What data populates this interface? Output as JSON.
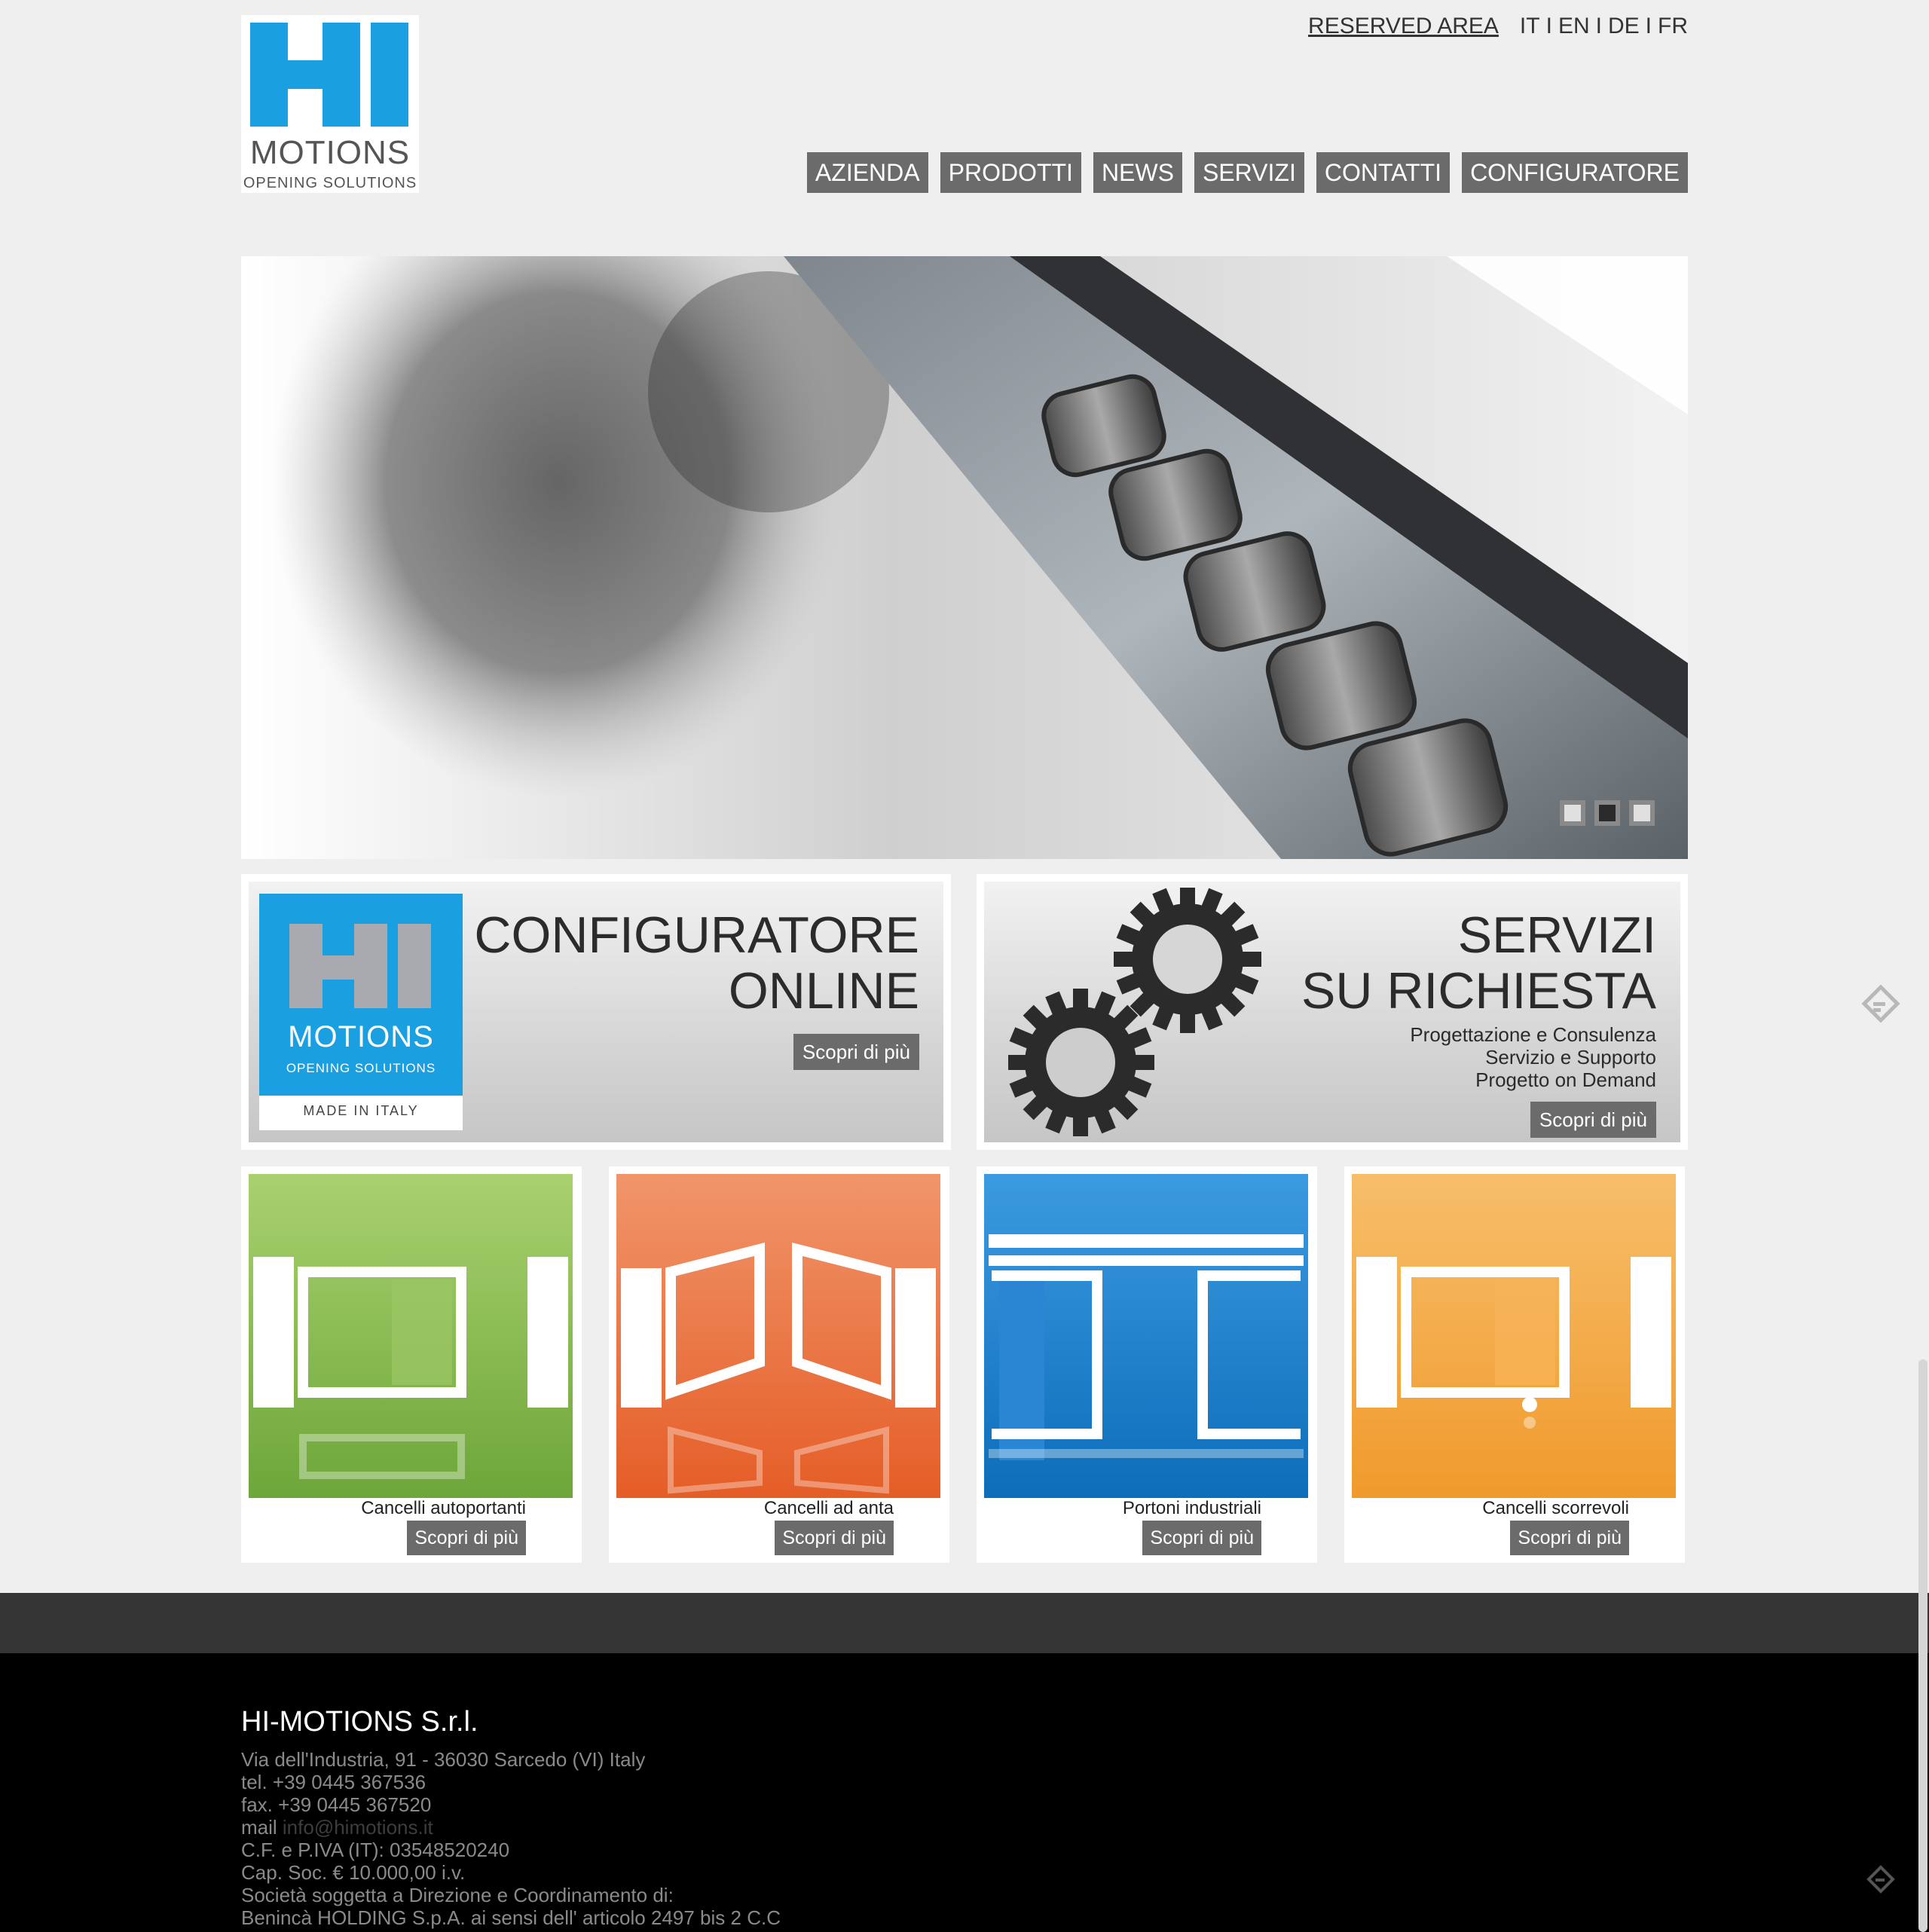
{
  "header": {
    "logo": {
      "hi": "HI",
      "motions": "MOTIONS",
      "tagline": "OPENING SOLUTIONS"
    },
    "reserved_area": "RESERVED AREA",
    "languages": [
      "IT",
      "EN",
      "DE",
      "FR"
    ],
    "lang_separator": "I",
    "nav": [
      "AZIENDA",
      "PRODOTTI",
      "NEWS",
      "SERVIZI",
      "CONTATTI",
      "CONFIGURATORE"
    ]
  },
  "hero": {
    "slide_count": 3,
    "active_slide": 2
  },
  "promos": {
    "configuratore": {
      "title_line1": "CONFIGURATORE",
      "title_line2": "ONLINE",
      "button": "Scopri di più",
      "logo": {
        "hi": "HI",
        "motions": "MOTIONS",
        "tagline": "OPENING SOLUTIONS",
        "made_in": "MADE IN ITALY"
      }
    },
    "servizi": {
      "title_line1": "SERVIZI",
      "title_line2": "SU RICHIESTA",
      "items": [
        "Progettazione e Consulenza",
        "Servizio e Supporto",
        "Progetto on Demand"
      ],
      "button": "Scopri di più",
      "icon": "gears-icon"
    }
  },
  "products": [
    {
      "label": "Cancelli autoportanti",
      "button": "Scopri di più",
      "color": "#7db548"
    },
    {
      "label": "Cancelli ad anta",
      "button": "Scopri di più",
      "color": "#ea6a34"
    },
    {
      "label": "Portoni industriali",
      "button": "Scopri di più",
      "color": "#1a7fc8"
    },
    {
      "label": "Cancelli scorrevoli",
      "button": "Scopri di più",
      "color": "#f2a33a"
    }
  ],
  "footer": {
    "company": "HI-MOTIONS S.r.l.",
    "address": "Via dell'Industria, 91 - 36030 Sarcedo (VI) Italy",
    "tel": "tel. +39 0445 367536",
    "fax": "fax. +39 0445 367520",
    "mail_label": "mail",
    "mail": "info@himotions.it",
    "vat": "C.F. e P.IVA (IT): 03548520240",
    "capital": "Cap. Soc. € 10.000,00 i.v.",
    "group_line1": "Società soggetta a Direzione e Coordinamento di:",
    "group_line2": "Benincà HOLDING S.p.A. ai sensi dell' articolo 2497 bis 2 C.C"
  },
  "colors": {
    "brand_blue": "#1a9fe0",
    "nav_bg": "#6b6b6b",
    "footer_bg": "#000000",
    "band_bg": "#353535"
  }
}
